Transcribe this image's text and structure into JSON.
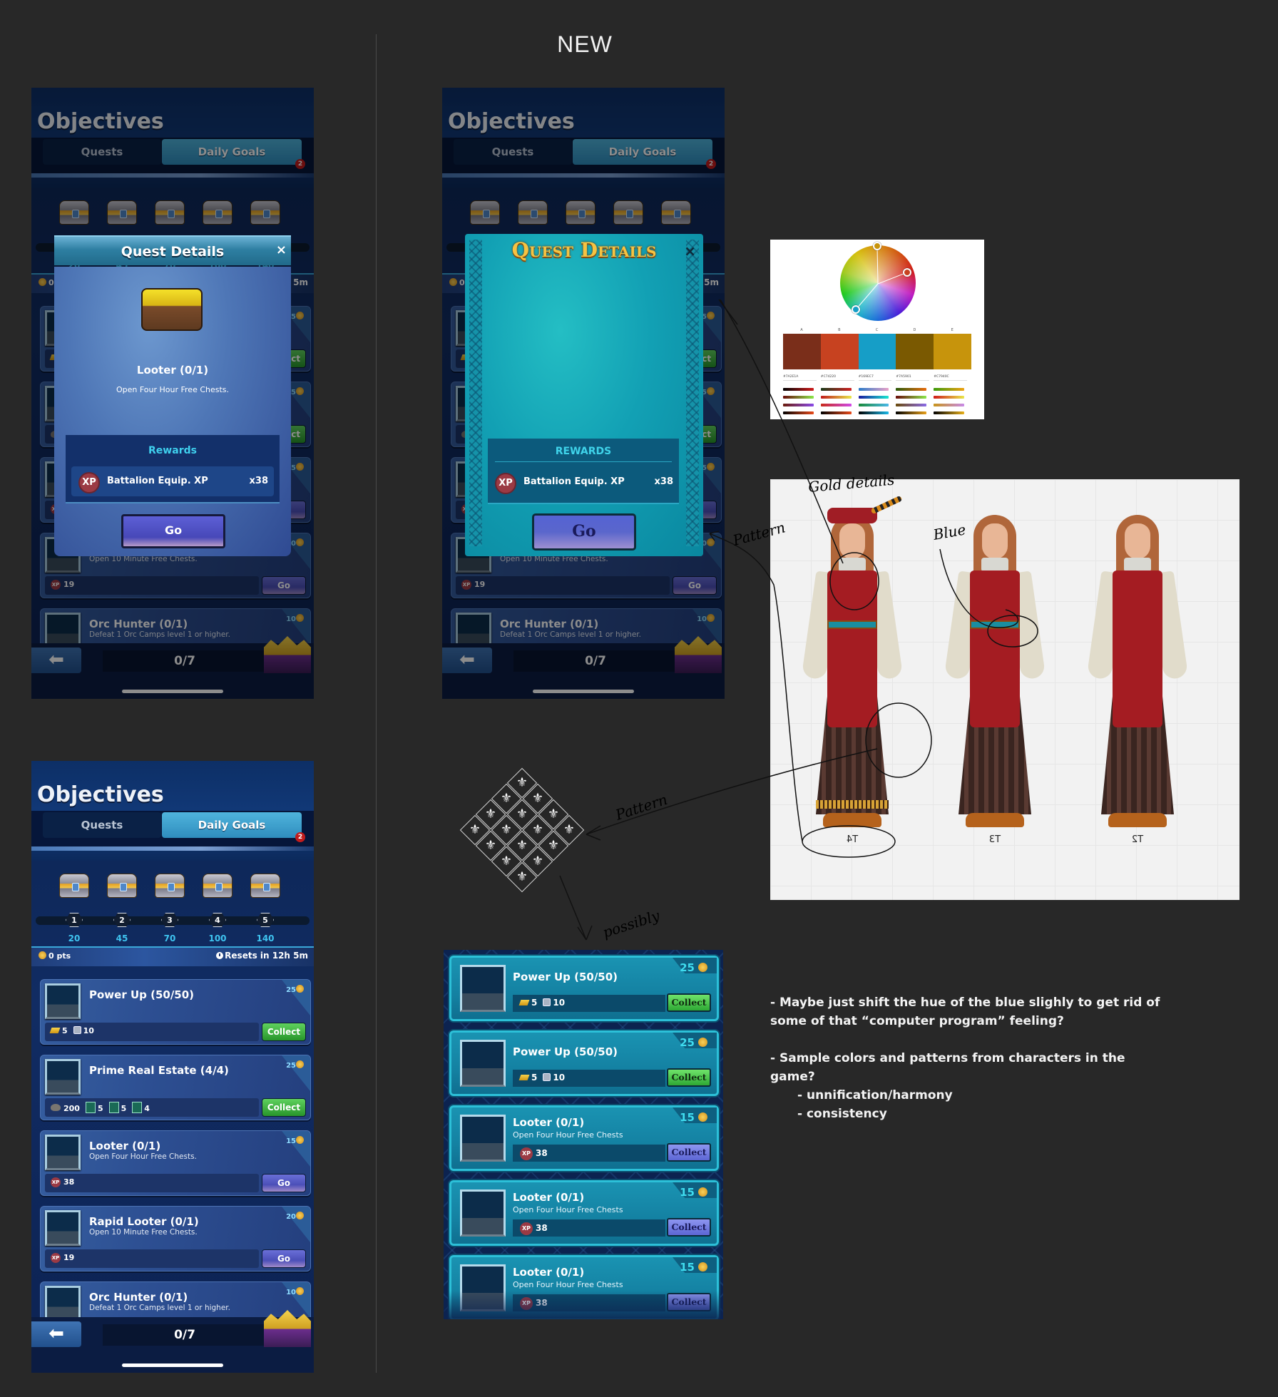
{
  "header": {
    "new_label": "NEW"
  },
  "objectives_screen": {
    "title": "Objectives",
    "tabs": [
      {
        "label": "Quests",
        "active": false
      },
      {
        "label": "Daily Goals",
        "active": true,
        "badge": "2"
      }
    ],
    "milestones": [
      {
        "step": "1",
        "points": "20"
      },
      {
        "step": "2",
        "points": "45"
      },
      {
        "step": "3",
        "points": "70"
      },
      {
        "step": "4",
        "points": "100"
      },
      {
        "step": "5",
        "points": "140"
      }
    ],
    "points_label": "0 pts",
    "reset_label": "Resets in 12h 5m",
    "progress_label": "0/7",
    "back_icon": "arrow-left-icon",
    "daily_goals": [
      {
        "title": "Power Up (50/50)",
        "desc": "",
        "points": "25",
        "rewards": [
          {
            "icon": "gold-bar-icon",
            "qty": "5"
          },
          {
            "icon": "rune-icon",
            "qty": "10"
          }
        ],
        "button": "Collect",
        "button_color": "#28952b"
      },
      {
        "title": "Prime Real Estate (4/4)",
        "desc": "",
        "points": "25",
        "rewards": [
          {
            "icon": "stone-icon",
            "qty": "200"
          },
          {
            "icon": "hourglass-icon",
            "qty": "5"
          },
          {
            "icon": "hourglass-icon",
            "qty": "5"
          },
          {
            "icon": "hourglass-icon",
            "qty": "4"
          }
        ],
        "button": "Collect",
        "button_color": "#28952b"
      },
      {
        "title": "Looter (0/1)",
        "desc": "Open Four Hour Free Chests.",
        "points": "15",
        "rewards": [
          {
            "icon": "xp-icon",
            "qty": "38"
          }
        ],
        "button": "Go",
        "button_color": "#4b4fb8"
      },
      {
        "title": "Rapid Looter (0/1)",
        "desc": "Open 10 Minute Free Chests.",
        "points": "20",
        "rewards": [
          {
            "icon": "xp-icon",
            "qty": "19"
          }
        ],
        "button": "Go",
        "button_color": "#4b4fb8"
      },
      {
        "title": "Orc Hunter (0/1)",
        "desc": "Defeat 1 Orc Camps level 1 or higher.",
        "points": "10",
        "rewards": [],
        "button": "",
        "button_color": "#4b4fb8"
      }
    ]
  },
  "quest_details_old": {
    "title": "Quest Details",
    "close": "×",
    "quest_name": "Looter (0/1)",
    "quest_desc": "Open Four Hour Free Chests.",
    "rewards_title": "Rewards",
    "reward": {
      "icon_text": "XP",
      "name": "Battalion Equip. XP",
      "qty": "x38"
    },
    "button": "Go"
  },
  "quest_details_new": {
    "title": "Quest Details",
    "close": "×",
    "rewards_title": "REWARDS",
    "reward": {
      "icon_text": "XP",
      "name": "Battalion Equip. XP",
      "qty": "x38"
    },
    "button": "Go"
  },
  "color_palette": {
    "swatch_labels": [
      "A",
      "B",
      "C",
      "D",
      "E"
    ],
    "swatches": [
      "#7A2E1A",
      "#C74220",
      "#169EC7",
      "#7A5901",
      "#C7940C"
    ]
  },
  "character_sheet": {
    "tiers": [
      "T4",
      "T3",
      "T2"
    ],
    "annotations": {
      "gold": "Gold details",
      "blue": "Blue",
      "pattern_left": "Pattern",
      "pattern_mid": "Pattern",
      "possibly": "possibly"
    }
  },
  "pattern": {
    "motif": "⚜",
    "cells": 16
  },
  "new_daily_goals": [
    {
      "title": "Power Up (50/50)",
      "desc": "",
      "points": "25",
      "rewards": [
        {
          "icon": "gold-bar-icon",
          "qty": "5"
        },
        {
          "icon": "rune-icon",
          "qty": "10"
        }
      ],
      "button": "Collect",
      "style": "green"
    },
    {
      "title": "Power Up (50/50)",
      "desc": "",
      "points": "25",
      "rewards": [
        {
          "icon": "gold-bar-icon",
          "qty": "5"
        },
        {
          "icon": "rune-icon",
          "qty": "10"
        }
      ],
      "button": "Collect",
      "style": "green"
    },
    {
      "title": "Looter (0/1)",
      "desc": "Open Four Hour Free Chests",
      "points": "15",
      "rewards": [
        {
          "icon": "xp-icon",
          "qty": "38"
        }
      ],
      "button": "Collect",
      "style": "purple"
    },
    {
      "title": "Looter (0/1)",
      "desc": "Open Four Hour Free Chests",
      "points": "15",
      "rewards": [
        {
          "icon": "xp-icon",
          "qty": "38"
        }
      ],
      "button": "Collect",
      "style": "purple"
    },
    {
      "title": "Looter (0/1)",
      "desc": "Open Four Hour Free Chests",
      "points": "15",
      "rewards": [
        {
          "icon": "xp-icon",
          "qty": "38"
        }
      ],
      "button": "Collect",
      "style": "purple"
    }
  ],
  "notes": {
    "line1": "- Maybe just shift the hue of the blue slighly to get rid of",
    "line2": "some of that “computer program” feeling?",
    "line3": "- Sample colors and patterns from characters in the game?",
    "line4": "- unnification/harmony",
    "line5": "- consistency"
  }
}
